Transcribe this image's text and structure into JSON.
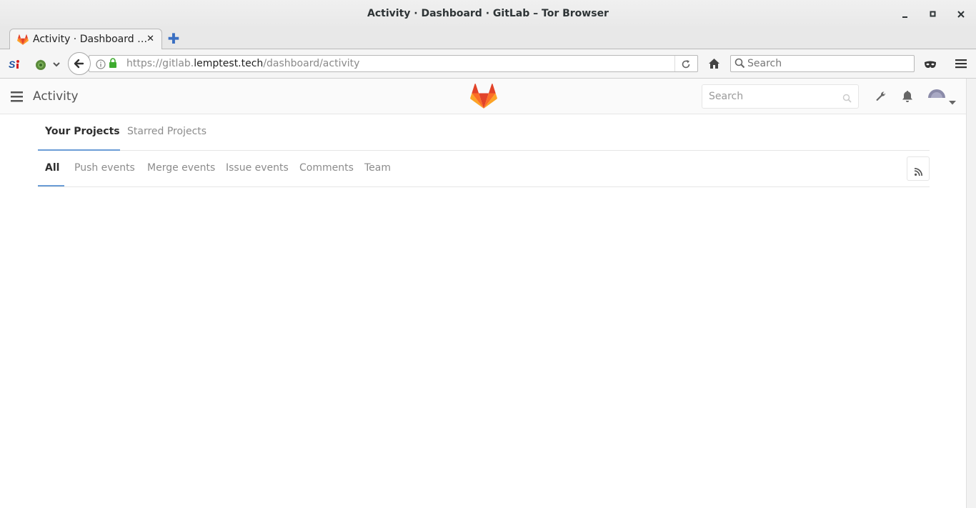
{
  "window": {
    "title": "Activity · Dashboard · GitLab – Tor Browser",
    "controls": [
      "minimize-icon",
      "maximize-icon",
      "close-icon"
    ]
  },
  "browser": {
    "tab": {
      "label": "Activity · Dashboard …",
      "favicon": "gitlab-tanuki-icon",
      "close_glyph": "✕"
    },
    "new_tab_glyph": "✚",
    "url": {
      "prefix": "https://gitlab.",
      "host": "lemptest.tech",
      "path": "/dashboard/activity"
    },
    "search_placeholder": "Search"
  },
  "gitlab": {
    "page_title": "Activity",
    "search_placeholder": "Search",
    "project_tabs": [
      {
        "label": "Your Projects",
        "active": true
      },
      {
        "label": "Starred Projects",
        "active": false
      }
    ],
    "event_tabs": [
      {
        "label": "All",
        "active": true
      },
      {
        "label": "Push events",
        "active": false
      },
      {
        "label": "Merge events",
        "active": false
      },
      {
        "label": "Issue events",
        "active": false
      },
      {
        "label": "Comments",
        "active": false
      },
      {
        "label": "Team",
        "active": false
      }
    ]
  },
  "colors": {
    "accent_underline": "#6b9dd6",
    "gitlab_orange": "#e24329",
    "gitlab_orange_light": "#fca326",
    "secure_green": "#3eab2f"
  }
}
